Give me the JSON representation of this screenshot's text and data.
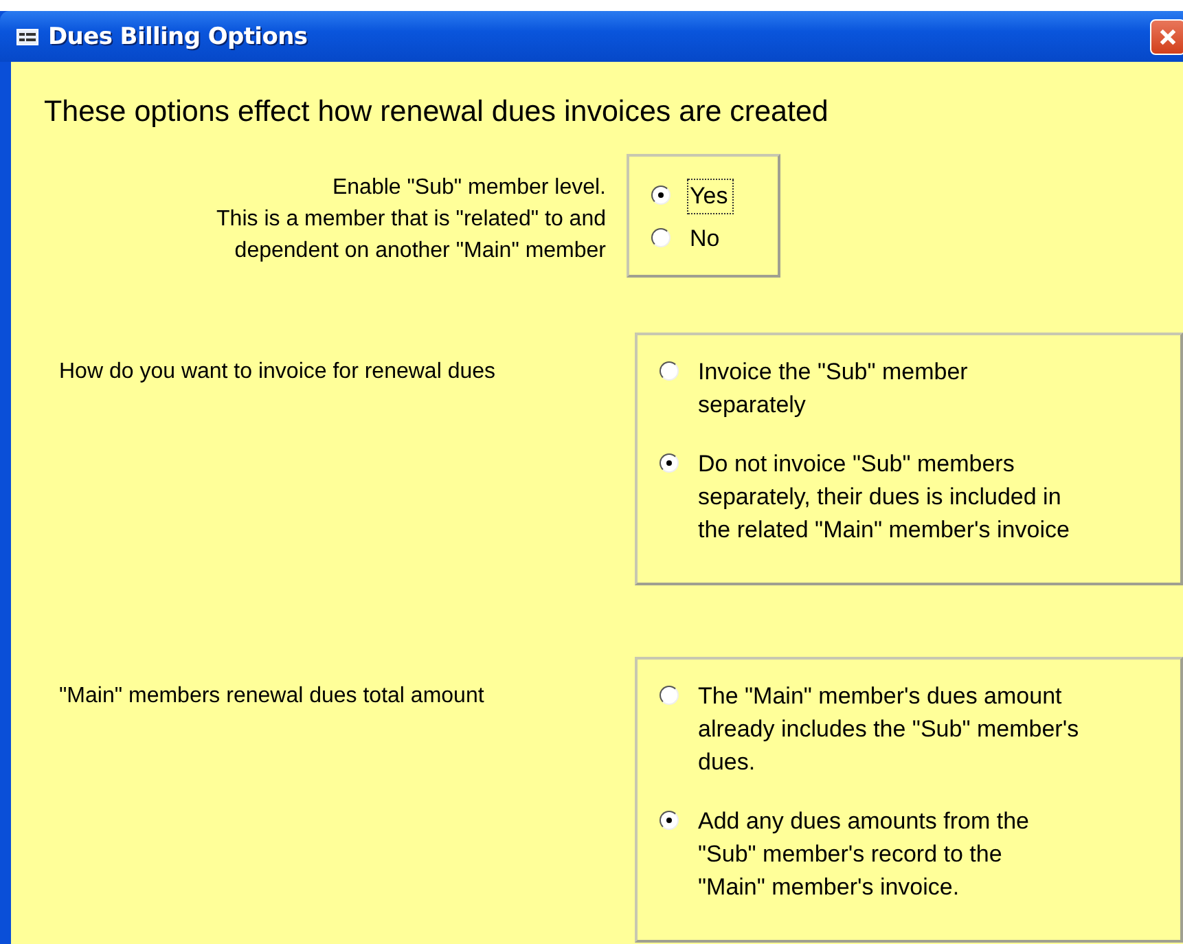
{
  "window": {
    "title": "Dues Billing Options"
  },
  "intro": "These options effect how renewal dues invoices are created",
  "groups": [
    {
      "label_lines": [
        "Enable \"Sub\" member level.",
        "This is a member that is \"related\" to  and",
        "dependent on another \"Main\" member"
      ],
      "options": [
        {
          "lines": [
            "Yes"
          ],
          "selected": true,
          "focused": true
        },
        {
          "lines": [
            "No"
          ],
          "selected": false,
          "focused": false
        }
      ]
    },
    {
      "label_lines": [
        "How do you want to invoice for renewal dues"
      ],
      "options": [
        {
          "lines": [
            "Invoice the \"Sub\" member",
            "separately"
          ],
          "selected": false,
          "focused": false
        },
        {
          "lines": [
            "Do not invoice \"Sub\" members",
            "separately, their dues is included in",
            "the related \"Main\" member's invoice"
          ],
          "selected": true,
          "focused": false
        }
      ]
    },
    {
      "label_lines": [
        "\"Main\" members renewal dues total amount"
      ],
      "options": [
        {
          "lines": [
            "The \"Main\" member's dues amount",
            "already includes the \"Sub\" member's",
            "dues."
          ],
          "selected": false,
          "focused": false
        },
        {
          "lines": [
            "Add any dues amounts from the",
            "\"Sub\" member's record to the",
            "\"Main\" member's invoice."
          ],
          "selected": true,
          "focused": false
        }
      ]
    }
  ]
}
